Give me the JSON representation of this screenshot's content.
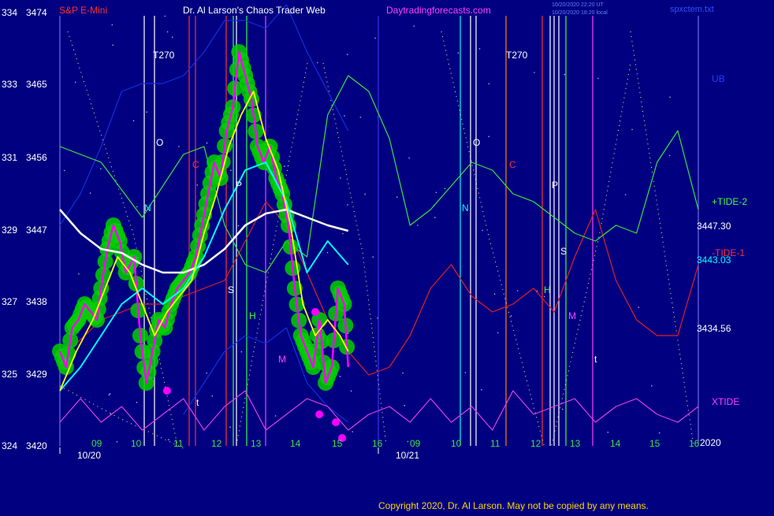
{
  "header": {
    "symbol": "S&P E-Mini",
    "title": "Dr. Al Larson's Chaos Trader Web",
    "site": "Daytradingforecasts.com",
    "timestamp_1": "10/20/2020 22:20 UT",
    "timestamp_2": "10/20/2020 18:20 local",
    "file": "spxctem.txt"
  },
  "copyright": "Copyright 2020, Dr. Al Larson. May not be copied by any means.",
  "colors": {
    "background": "#000080",
    "price_bars": "#ff00ff",
    "highlight_blobs": "#00e000",
    "yellow_avg": "#ffff00",
    "cyan_avg": "#00ffff",
    "white_curve": "#ffffff",
    "tide2": "#40e040",
    "tide1": "#e02020",
    "xtide": "#e040e0",
    "ub": "#1030e0"
  },
  "chart_data": {
    "type": "line",
    "title": "S&P E-Mini",
    "y_left_labels": [
      "334",
      "333",
      "331",
      "329",
      "327",
      "325",
      "324"
    ],
    "y_price_labels": [
      "3474",
      "3465",
      "3456",
      "3447",
      "3438",
      "3429",
      "3420"
    ],
    "ylim": [
      3420,
      3474
    ],
    "x_hour_labels": [
      "09",
      "10",
      "11",
      "12",
      "13",
      "14",
      "15",
      "16",
      "09",
      "10",
      "11",
      "12",
      "13",
      "14",
      "15",
      "16"
    ],
    "x_date_labels": [
      "10/20",
      "10/21"
    ],
    "x_end_label": "2020",
    "right_labels": [
      {
        "text": "UB",
        "color": "#2040ff"
      },
      {
        "text": "+TIDE-2",
        "color": "#40ff40"
      },
      {
        "text": "3447.30",
        "color": "#ffffff"
      },
      {
        "text": "-TIDE-1",
        "color": "#ff3030"
      },
      {
        "text": "3443.03",
        "color": "#00ffff"
      },
      {
        "text": "3434.56",
        "color": "#ffffff"
      },
      {
        "text": "XTIDE",
        "color": "#ff40ff"
      }
    ],
    "markers": [
      {
        "text": "T270",
        "color": "#ffffff"
      },
      {
        "text": "O",
        "color": "#ffffff"
      },
      {
        "text": "C",
        "color": "#ff3030"
      },
      {
        "text": "N",
        "color": "#00ffff"
      },
      {
        "text": "P",
        "color": "#ffffff"
      },
      {
        "text": "S",
        "color": "#ffffff"
      },
      {
        "text": "H",
        "color": "#40ff40"
      },
      {
        "text": "M",
        "color": "#ff40ff"
      },
      {
        "text": "t",
        "color": "#ffffff"
      },
      {
        "text": "T270",
        "color": "#ffffff"
      },
      {
        "text": "O",
        "color": "#ffffff"
      },
      {
        "text": "C",
        "color": "#ff3030"
      },
      {
        "text": "N",
        "color": "#00ffff"
      },
      {
        "text": "P",
        "color": "#ffffff"
      },
      {
        "text": "S",
        "color": "#ffffff"
      },
      {
        "text": "H",
        "color": "#40ff40"
      },
      {
        "text": "M",
        "color": "#ff40ff"
      },
      {
        "text": "t",
        "color": "#ffffff"
      }
    ],
    "series": [
      {
        "key": "price",
        "color": "#ff00ff",
        "x": [
          0,
          0.15,
          0.3,
          0.45,
          0.6,
          0.75,
          0.9,
          1.0,
          1.15,
          1.3,
          1.45,
          1.6,
          1.8,
          1.95,
          2.1,
          2.25,
          2.4,
          2.55,
          2.7,
          2.85,
          3.0,
          3.15,
          3.3,
          3.45,
          3.6,
          3.75,
          3.9,
          4.05,
          4.2,
          4.35,
          4.5,
          4.65,
          4.8,
          4.95,
          5.1,
          5.25,
          5.4,
          5.55,
          5.7,
          5.85,
          6.0,
          6.15,
          6.3,
          6.45,
          6.6,
          6.75,
          6.9,
          7.0
        ],
        "y": [
          3432,
          3430,
          3435,
          3436,
          3438,
          3437,
          3436,
          3440,
          3445,
          3448,
          3446,
          3442,
          3444,
          3434,
          3428,
          3432,
          3436,
          3435,
          3438,
          3440,
          3441,
          3442,
          3444,
          3448,
          3452,
          3456,
          3454,
          3460,
          3463,
          3470,
          3467,
          3464,
          3458,
          3456,
          3458,
          3454,
          3452,
          3448,
          3440,
          3434,
          3432,
          3430,
          3436,
          3428,
          3430,
          3440,
          3438,
          3430
        ]
      },
      {
        "key": "yellow_avg",
        "color": "#ffff00",
        "x": [
          0,
          0.4,
          0.8,
          1.1,
          1.4,
          1.7,
          2.0,
          2.3,
          2.6,
          2.9,
          3.2,
          3.5,
          3.8,
          4.1,
          4.4,
          4.7,
          5.0,
          5.3,
          5.6,
          5.9,
          6.2,
          6.5,
          6.8,
          7.0
        ],
        "y": [
          3427,
          3432,
          3436,
          3440,
          3444,
          3442,
          3438,
          3434,
          3437,
          3439,
          3441,
          3447,
          3452,
          3458,
          3462,
          3465,
          3459,
          3455,
          3448,
          3438,
          3434,
          3436,
          3434,
          3432
        ]
      },
      {
        "key": "cyan_avg",
        "color": "#00ffff",
        "x": [
          0,
          0.5,
          1.0,
          1.5,
          2.0,
          2.5,
          3.0,
          3.5,
          4.0,
          4.5,
          5.0,
          5.5,
          6.0,
          6.5,
          7.0
        ],
        "y": [
          3427,
          3430,
          3434,
          3438,
          3440,
          3438,
          3440,
          3444,
          3450,
          3455,
          3456,
          3451,
          3442,
          3446,
          3443
        ]
      },
      {
        "key": "white_curve",
        "color": "#ffffff",
        "x": [
          0,
          0.5,
          1.0,
          1.5,
          2.0,
          2.5,
          3.0,
          3.5,
          4.0,
          4.5,
          5.0,
          5.5,
          6.0,
          6.5,
          7.0
        ],
        "y": [
          3450,
          3447,
          3445,
          3444.5,
          3443,
          3442,
          3442,
          3443,
          3445,
          3448,
          3449.5,
          3450,
          3449,
          3448,
          3447.3
        ]
      },
      {
        "key": "tide2",
        "color": "#40e040",
        "x": [
          0,
          1,
          2,
          3,
          3.5,
          4,
          4.5,
          5,
          5.5,
          6,
          6.5,
          7,
          7.5,
          8,
          8.5,
          9,
          9.5,
          10,
          10.5,
          11,
          11.5,
          12,
          12.5,
          13,
          13.5,
          14,
          14.5,
          15,
          15.5
        ],
        "y": [
          3458,
          3456,
          3449,
          3457,
          3458,
          3448,
          3443,
          3442,
          3446,
          3444,
          3462,
          3467,
          3465,
          3459,
          3448,
          3450,
          3453,
          3456,
          3455,
          3452,
          3451,
          3449,
          3447,
          3446,
          3448,
          3447,
          3456,
          3460,
          3450
        ]
      },
      {
        "key": "tide1",
        "color": "#e02020",
        "x": [
          0,
          1,
          2,
          2.5,
          3,
          3.5,
          4,
          4.5,
          5,
          5.5,
          6,
          6.5,
          7,
          7.5,
          8,
          8.5,
          9,
          9.5,
          10,
          10.5,
          11,
          11.5,
          12,
          12.5,
          13,
          13.5,
          14,
          14.5,
          15,
          15.5
        ],
        "y": [
          3431,
          3436,
          3438,
          3438,
          3439,
          3440,
          3441,
          3446,
          3451,
          3448,
          3442,
          3436,
          3432,
          3429,
          3430,
          3434,
          3440,
          3443,
          3439,
          3437,
          3438,
          3440,
          3437,
          3444,
          3450,
          3441,
          3436,
          3434,
          3434,
          3443
        ]
      },
      {
        "key": "xtide",
        "color": "#e040e0",
        "x": [
          0,
          0.5,
          1,
          1.5,
          2,
          2.5,
          3,
          3.5,
          4,
          4.5,
          5,
          5.5,
          6,
          6.5,
          7,
          7.5,
          8,
          8.5,
          9,
          9.5,
          10,
          10.5,
          11,
          11.5,
          12,
          12.5,
          13,
          13.5,
          14,
          14.5,
          15,
          15.5
        ],
        "y": [
          3423,
          3426,
          3423,
          3425,
          3422,
          3424,
          3426,
          3422,
          3425,
          3427,
          3422,
          3424,
          3426,
          3425,
          3422,
          3424,
          3425,
          3423,
          3426,
          3423,
          3425,
          3422,
          3427,
          3424,
          3425,
          3426,
          3423,
          3425,
          3426,
          3424,
          3423,
          3425
        ]
      },
      {
        "key": "ub",
        "color": "#1030e0",
        "x": [
          0,
          0.5,
          1,
          1.5,
          2,
          2.5,
          3,
          3.5,
          4,
          4.5,
          5,
          5.5,
          6,
          6.5,
          7
        ],
        "y": [
          3448,
          3452,
          3458,
          3465,
          3466,
          3466,
          3467,
          3470,
          3474,
          3474,
          3473,
          3476,
          3470,
          3465,
          3460
        ]
      },
      {
        "key": "lb",
        "color": "#1030e0",
        "x": [
          3,
          3.5,
          4,
          4.5,
          5,
          5.5,
          6,
          6.5,
          7
        ],
        "y": [
          3424,
          3428,
          3432,
          3434,
          3433,
          3435,
          3428,
          3425,
          3423
        ]
      }
    ]
  }
}
